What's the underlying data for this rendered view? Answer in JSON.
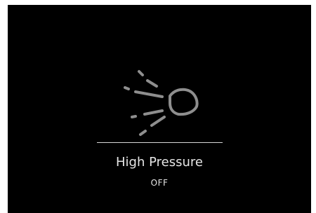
{
  "feature": {
    "title": "High Pressure",
    "status": "OFF",
    "icon": "high-pressure-nozzle-icon",
    "colors": {
      "background": "#000000",
      "icon": "#8e8e8e",
      "text": "#e6e6e6",
      "divider": "#d8d8d8"
    }
  }
}
